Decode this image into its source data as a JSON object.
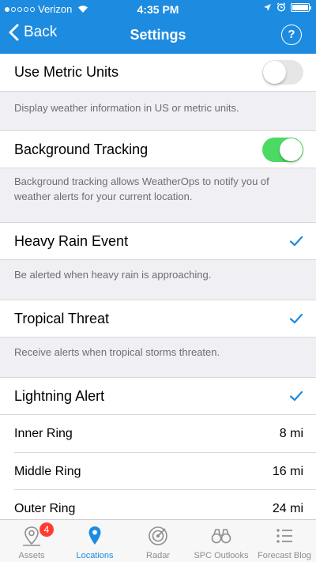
{
  "status_bar": {
    "carrier": "Verizon",
    "time": "4:35 PM"
  },
  "nav": {
    "back_label": "Back",
    "title": "Settings",
    "help_label": "?"
  },
  "settings": {
    "metric": {
      "label": "Use Metric Units",
      "enabled": false,
      "description": "Display weather information in US or metric units."
    },
    "background": {
      "label": "Background Tracking",
      "enabled": true,
      "description": "Background tracking allows WeatherOps to notify you of weather alerts for your current location."
    },
    "heavy_rain": {
      "label": "Heavy Rain Event",
      "checked": true,
      "description": "Be alerted when heavy rain is approaching."
    },
    "tropical": {
      "label": "Tropical Threat",
      "checked": true,
      "description": "Receive alerts when tropical storms threaten."
    },
    "lightning": {
      "label": "Lightning Alert",
      "checked": true,
      "rings": [
        {
          "label": "Inner Ring",
          "value": "8 mi"
        },
        {
          "label": "Middle Ring",
          "value": "16 mi"
        },
        {
          "label": "Outer Ring",
          "value": "24 mi"
        }
      ]
    }
  },
  "tabs": [
    {
      "label": "Assets",
      "icon": "map-pin-outline-icon",
      "badge": "4"
    },
    {
      "label": "Locations",
      "icon": "location-pin-icon",
      "active": true
    },
    {
      "label": "Radar",
      "icon": "radar-icon"
    },
    {
      "label": "SPC Outlooks",
      "icon": "binoculars-icon"
    },
    {
      "label": "Forecast Blog",
      "icon": "list-icon"
    }
  ],
  "colors": {
    "brand": "#1c8be0",
    "toggle_on": "#4cd964",
    "badge": "#ff3b30"
  }
}
